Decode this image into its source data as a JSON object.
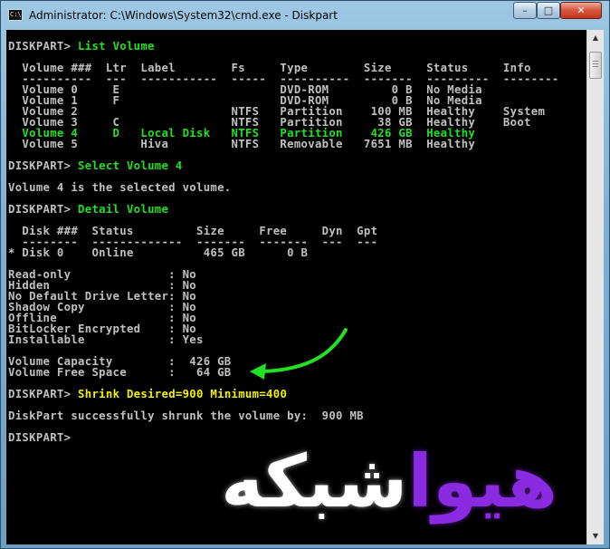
{
  "window": {
    "title": "Administrator: C:\\Windows\\System32\\cmd.exe - Diskpart",
    "icon": "cmd-icon",
    "minimize": "–",
    "maximize": "□",
    "close": "✕"
  },
  "console": {
    "lines": [
      {
        "text": "DISKPART> ",
        "cmd": "List Volume",
        "cmd_color": "green"
      },
      {
        "text": ""
      },
      {
        "text": "  Volume ###  Ltr  Label        Fs     Type        Size     Status     Info"
      },
      {
        "text": "  ----------  ---  -----------  -----  ----------  -------  ---------  --------"
      },
      {
        "text": "  Volume 0     E                       DVD-ROM         0 B  No Media"
      },
      {
        "text": "  Volume 1     F                       DVD-ROM         0 B  No Media"
      },
      {
        "text": "  Volume 2                      NTFS   Partition    100 MB  Healthy    System"
      },
      {
        "text": "  Volume 3     C                NTFS   Partition     38 GB  Healthy    Boot"
      },
      {
        "text": "  Volume 4     D   Local Disk   NTFS   Partition    426 GB  Healthy",
        "color": "green"
      },
      {
        "text": "  Volume 5         Hiva         NTFS   Removable   7651 MB  Healthy"
      },
      {
        "text": ""
      },
      {
        "text": "DISKPART> ",
        "cmd": "Select Volume 4",
        "cmd_color": "green"
      },
      {
        "text": ""
      },
      {
        "text": "Volume 4 is the selected volume."
      },
      {
        "text": ""
      },
      {
        "text": "DISKPART> ",
        "cmd": "Detail Volume",
        "cmd_color": "green"
      },
      {
        "text": ""
      },
      {
        "text": "  Disk ###  Status         Size     Free     Dyn  Gpt"
      },
      {
        "text": "  --------  -------------  -------  -------  ---  ---"
      },
      {
        "text": "* Disk 0    Online          465 GB      0 B"
      },
      {
        "text": ""
      },
      {
        "text": "Read-only              : No"
      },
      {
        "text": "Hidden                 : No"
      },
      {
        "text": "No Default Drive Letter: No"
      },
      {
        "text": "Shadow Copy            : No"
      },
      {
        "text": "Offline                : No"
      },
      {
        "text": "BitLocker Encrypted    : No"
      },
      {
        "text": "Installable            : Yes"
      },
      {
        "text": ""
      },
      {
        "text": "Volume Capacity        :  426 GB"
      },
      {
        "text": "Volume Free Space      :   64 GB"
      },
      {
        "text": ""
      },
      {
        "text": "DISKPART> ",
        "cmd": "Shrink Desired=900 Minimum=400",
        "cmd_color": "yellow"
      },
      {
        "text": ""
      },
      {
        "text": "DiskPart successfully shrunk the volume by:  900 MB"
      },
      {
        "text": ""
      },
      {
        "text": "DISKPART> "
      }
    ]
  },
  "scrollbar": {
    "up": "▲",
    "down": "▼"
  },
  "annotation": {
    "arrow_color": "#22e022",
    "icon": "curved-arrow-icon"
  },
  "watermark": {
    "part_a": "هیوا",
    "part_b": "شبکه",
    "color_a": "#8a2be2",
    "color_b": "#ffffff"
  }
}
